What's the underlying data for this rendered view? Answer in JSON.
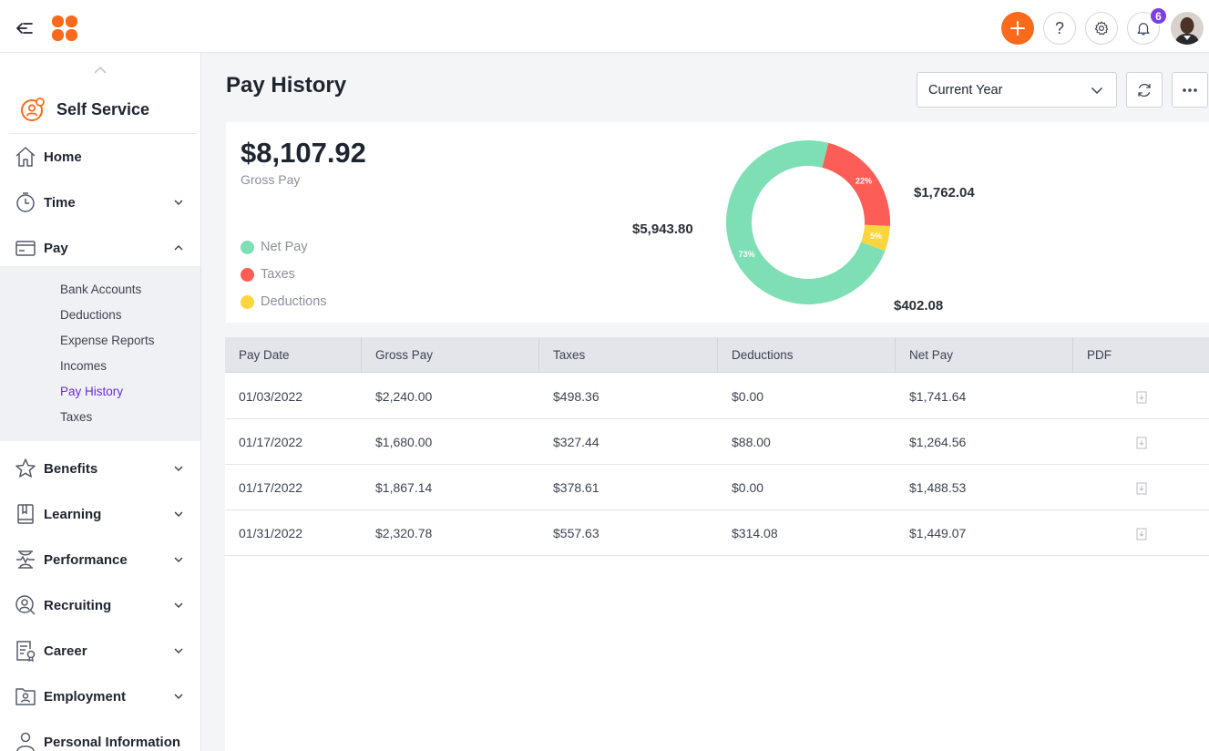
{
  "colors": {
    "accent": "#fa6a1c",
    "active_nav": "#6a2dd8",
    "badge": "#7b3fe4",
    "net_pay": "#7ddfb3",
    "taxes": "#fc5e57",
    "deductions": "#fbd53d"
  },
  "topbar": {
    "icons": [
      "collapse-menu-icon",
      "app-logo",
      "plus-icon",
      "help-icon",
      "gear-icon",
      "bell-icon",
      "user-avatar"
    ],
    "help_glyph": "?",
    "notifications_count": "6"
  },
  "sidebar": {
    "module_title": "Self Service",
    "items": [
      {
        "label": "Home",
        "icon": "home-icon",
        "expandable": false
      },
      {
        "label": "Time",
        "icon": "clock-icon",
        "expandable": true
      },
      {
        "label": "Pay",
        "icon": "wallet-icon",
        "expandable": true,
        "expanded": true
      },
      {
        "label": "Benefits",
        "icon": "star-icon",
        "expandable": true
      },
      {
        "label": "Learning",
        "icon": "book-icon",
        "expandable": true
      },
      {
        "label": "Performance",
        "icon": "performance-icon",
        "expandable": true
      },
      {
        "label": "Recruiting",
        "icon": "recruiting-icon",
        "expandable": true
      },
      {
        "label": "Career",
        "icon": "career-icon",
        "expandable": true
      },
      {
        "label": "Employment",
        "icon": "employment-icon",
        "expandable": true
      },
      {
        "label": "Personal Information",
        "icon": "person-icon",
        "expandable": false
      }
    ],
    "pay_subitems": [
      "Bank Accounts",
      "Deductions",
      "Expense Reports",
      "Incomes",
      "Pay History",
      "Taxes"
    ],
    "active_subitem": "Pay History"
  },
  "main": {
    "title": "Pay History",
    "period_select": "Current Year",
    "summary": {
      "gross_amount": "$8,107.92",
      "gross_label": "Gross Pay",
      "legend": [
        "Net Pay",
        "Taxes",
        "Deductions"
      ]
    },
    "table": {
      "columns": [
        "Pay Date",
        "Gross Pay",
        "Taxes",
        "Deductions",
        "Net Pay",
        "PDF"
      ],
      "rows": [
        [
          "01/03/2022",
          "$2,240.00",
          "$498.36",
          "$0.00",
          "$1,741.64"
        ],
        [
          "01/17/2022",
          "$1,680.00",
          "$327.44",
          "$88.00",
          "$1,264.56"
        ],
        [
          "01/17/2022",
          "$1,867.14",
          "$378.61",
          "$0.00",
          "$1,488.53"
        ],
        [
          "01/31/2022",
          "$2,320.78",
          "$557.63",
          "$314.08",
          "$1,449.07"
        ]
      ]
    }
  },
  "chart_data": {
    "type": "pie",
    "categories": [
      "Net Pay",
      "Taxes",
      "Deductions"
    ],
    "values": [
      5943.8,
      1762.04,
      402.08
    ],
    "value_labels": [
      "$5,943.80",
      "$1,762.04",
      "$402.08"
    ],
    "percent_labels": [
      "73%",
      "22%",
      "5%"
    ],
    "colors": [
      "#7ddfb3",
      "#fc5e57",
      "#fbd53d"
    ]
  }
}
